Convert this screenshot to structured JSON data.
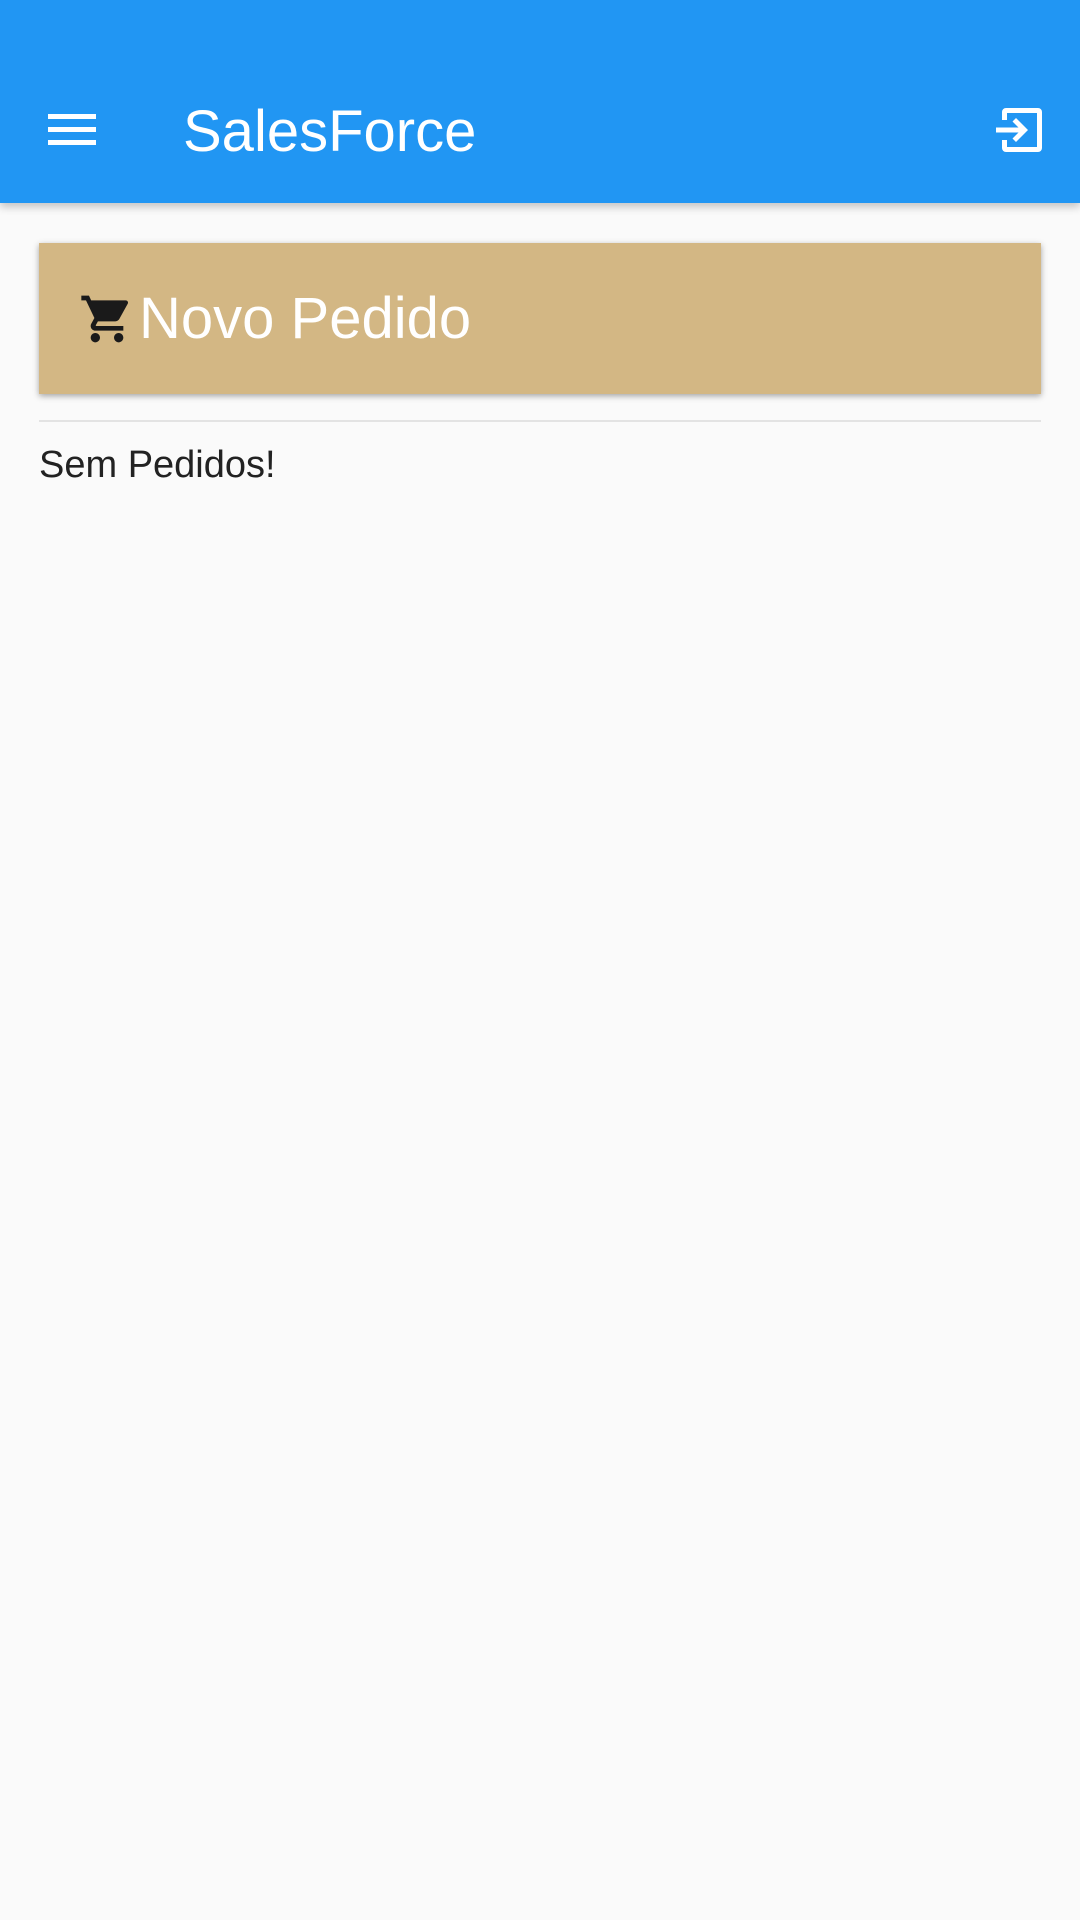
{
  "app_bar": {
    "title": "SalesForce",
    "menu_icon": "menu-icon",
    "logout_icon": "logout-icon",
    "background": "#2196f3"
  },
  "new_order": {
    "label": "Novo Pedido",
    "icon": "cart-icon",
    "background": "#d3b784"
  },
  "orders": {
    "empty_message": "Sem Pedidos!"
  }
}
